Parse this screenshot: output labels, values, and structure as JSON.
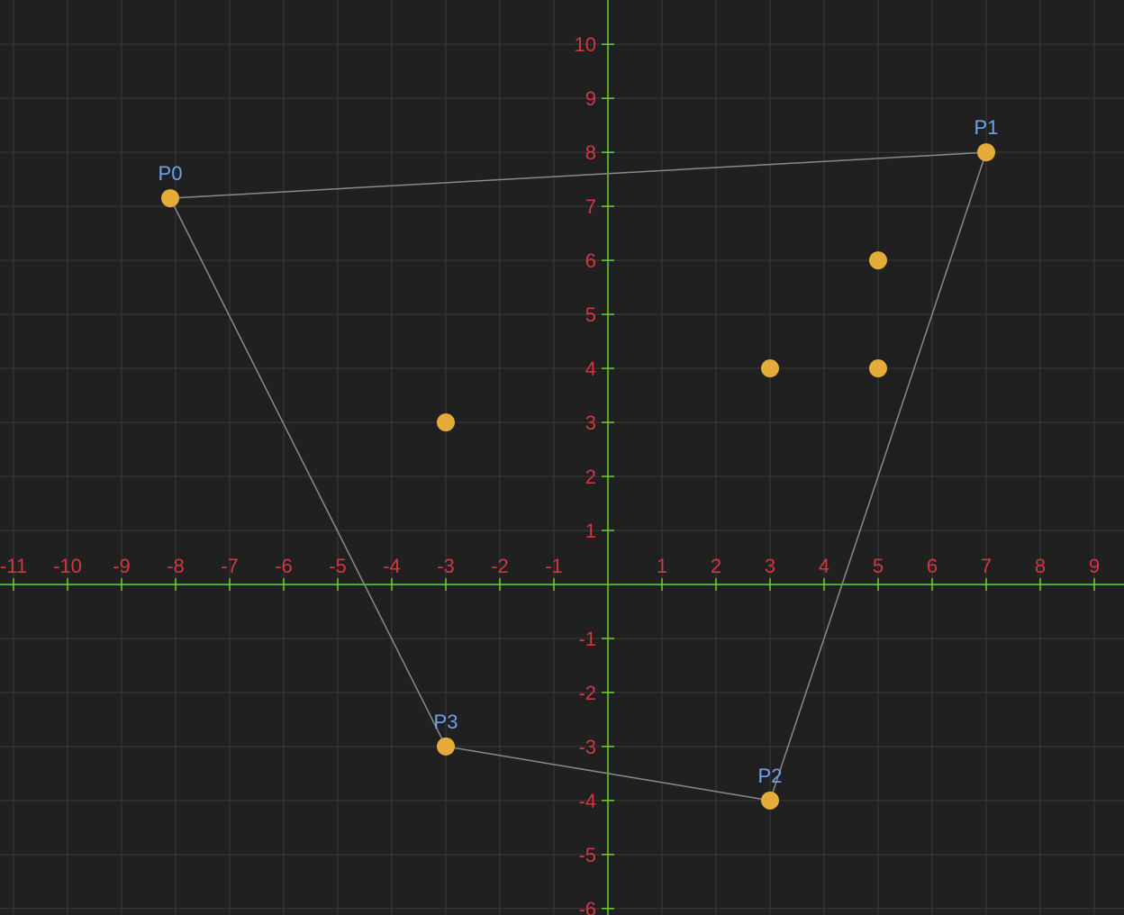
{
  "chart_data": {
    "type": "scatter",
    "title": "",
    "xlabel": "",
    "ylabel": "",
    "xlim": [
      -11.25,
      9.55
    ],
    "ylim": [
      -6.12,
      10.82
    ],
    "x_ticks": [
      -11,
      -10,
      -9,
      -8,
      -7,
      -6,
      -5,
      -4,
      -3,
      -2,
      -1,
      1,
      2,
      3,
      4,
      5,
      6,
      7,
      8,
      9
    ],
    "y_ticks": [
      -6,
      -5,
      -4,
      -3,
      -2,
      -1,
      1,
      2,
      3,
      4,
      5,
      6,
      7,
      8,
      9,
      10
    ],
    "grid": true,
    "points": [
      {
        "x": -8.1,
        "y": 7.15,
        "label": "P0"
      },
      {
        "x": 7,
        "y": 8,
        "label": "P1"
      },
      {
        "x": 3,
        "y": -4,
        "label": "P2"
      },
      {
        "x": -3,
        "y": -3,
        "label": "P3"
      },
      {
        "x": 5,
        "y": 6,
        "label": ""
      },
      {
        "x": 3,
        "y": 4,
        "label": ""
      },
      {
        "x": 5,
        "y": 4,
        "label": ""
      },
      {
        "x": -3,
        "y": 3,
        "label": ""
      }
    ],
    "hull": [
      "P0",
      "P1",
      "P2",
      "P3"
    ],
    "colors": {
      "background": "#202020",
      "grid": "#3a3a3a",
      "axis": "#6fcf3a",
      "tick_label": "#d2373f",
      "point": "#e6ac3a",
      "point_label": "#6ea0ec",
      "hull_edge": "#8a8a8a"
    }
  }
}
